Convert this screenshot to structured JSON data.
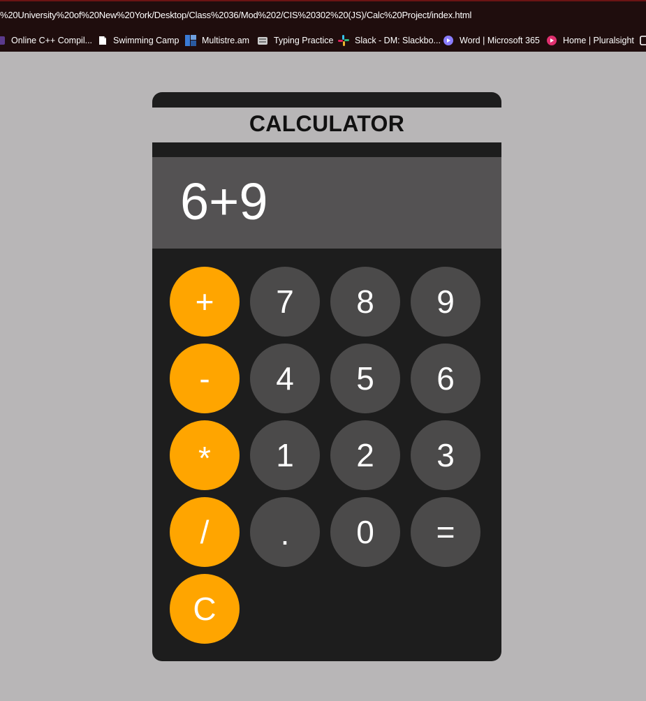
{
  "browser": {
    "address": "%20University%20of%20New%20York/Desktop/Class%2036/Mod%202/CIS%20302%20(JS)/Calc%20Project/index.html",
    "bookmarks": [
      {
        "label": "Online C++ Compil...",
        "icon": "compiler-icon",
        "color": "#5b3a8c"
      },
      {
        "label": "Swimming Camp",
        "icon": "document-icon",
        "color": "#ffffff"
      },
      {
        "label": "Multistre.am",
        "icon": "multistream-icon",
        "color": "#3a7bd5"
      },
      {
        "label": "Typing Practice",
        "icon": "typing-icon",
        "color": "#cccccc"
      },
      {
        "label": "Slack - DM: Slackbo...",
        "icon": "slack-icon",
        "color": "#e01e5a"
      },
      {
        "label": "Word | Microsoft 365",
        "icon": "word-icon",
        "color": "#8a7dff"
      },
      {
        "label": "Home | Pluralsight",
        "icon": "pluralsight-icon",
        "color": "#e0306f"
      }
    ]
  },
  "calculator": {
    "title": "CALCULATOR",
    "display": "6+9",
    "colors": {
      "operator": "#ffa500",
      "number": "#4b4a4a",
      "body": "#1d1d1d",
      "display": "#545253"
    },
    "keys": [
      {
        "label": "+",
        "name": "plus-button",
        "type": "op"
      },
      {
        "label": "7",
        "name": "seven-button",
        "type": "num"
      },
      {
        "label": "8",
        "name": "eight-button",
        "type": "num"
      },
      {
        "label": "9",
        "name": "nine-button",
        "type": "num"
      },
      {
        "label": "-",
        "name": "minus-button",
        "type": "op"
      },
      {
        "label": "4",
        "name": "four-button",
        "type": "num"
      },
      {
        "label": "5",
        "name": "five-button",
        "type": "num"
      },
      {
        "label": "6",
        "name": "six-button",
        "type": "num"
      },
      {
        "label": "*",
        "name": "multiply-button",
        "type": "op"
      },
      {
        "label": "1",
        "name": "one-button",
        "type": "num"
      },
      {
        "label": "2",
        "name": "two-button",
        "type": "num"
      },
      {
        "label": "3",
        "name": "three-button",
        "type": "num"
      },
      {
        "label": "/",
        "name": "divide-button",
        "type": "op"
      },
      {
        "label": ".",
        "name": "decimal-button",
        "type": "num"
      },
      {
        "label": "0",
        "name": "zero-button",
        "type": "num"
      },
      {
        "label": "=",
        "name": "equals-button",
        "type": "num"
      },
      {
        "label": "C",
        "name": "clear-button",
        "type": "op"
      }
    ]
  }
}
